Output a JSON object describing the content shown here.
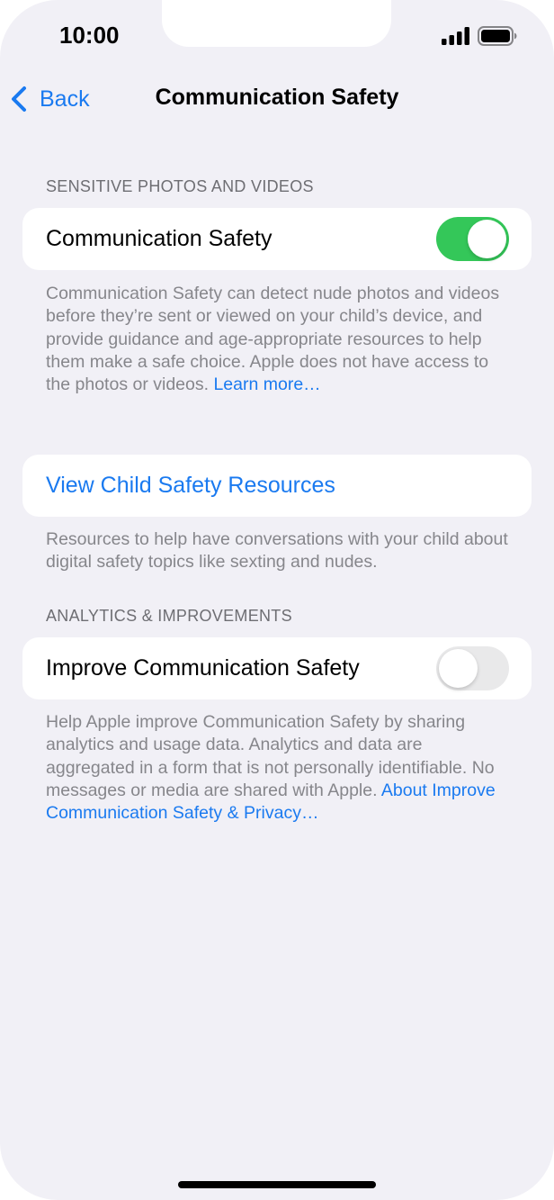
{
  "status_bar": {
    "time": "10:00"
  },
  "nav": {
    "back_label": "Back",
    "title": "Communication Safety"
  },
  "sections": {
    "sensitive": {
      "header": "SENSITIVE PHOTOS AND VIDEOS",
      "toggle_label": "Communication Safety",
      "toggle_on": true,
      "footer": "Communication Safety can detect nude photos and videos before they’re sent or viewed on your child’s device, and provide guidance and age-appropriate resources to help them make a safe choice. Apple does not have access to the photos or videos. ",
      "footer_link": "Learn more…"
    },
    "resources": {
      "link_label": "View Child Safety Resources",
      "footer": "Resources to help have conversations with your child about digital safety topics like sexting and nudes."
    },
    "analytics": {
      "header": "ANALYTICS & IMPROVEMENTS",
      "toggle_label": "Improve Communication Safety",
      "toggle_on": false,
      "footer": "Help Apple improve Communication Safety by sharing analytics and usage data. Analytics and data are aggregated in a form that is not personally identifiable. No messages or media are shared with Apple. ",
      "footer_link": "About Improve Communication Safety & Privacy…"
    }
  },
  "icons": {
    "back": "chevron-left-icon",
    "signal": "cellular-signal-icon",
    "battery": "battery-icon"
  },
  "colors": {
    "accent": "#1a7af0",
    "toggle_on": "#34c759",
    "toggle_off": "#e9e9ea",
    "background": "#f1f0f6"
  }
}
